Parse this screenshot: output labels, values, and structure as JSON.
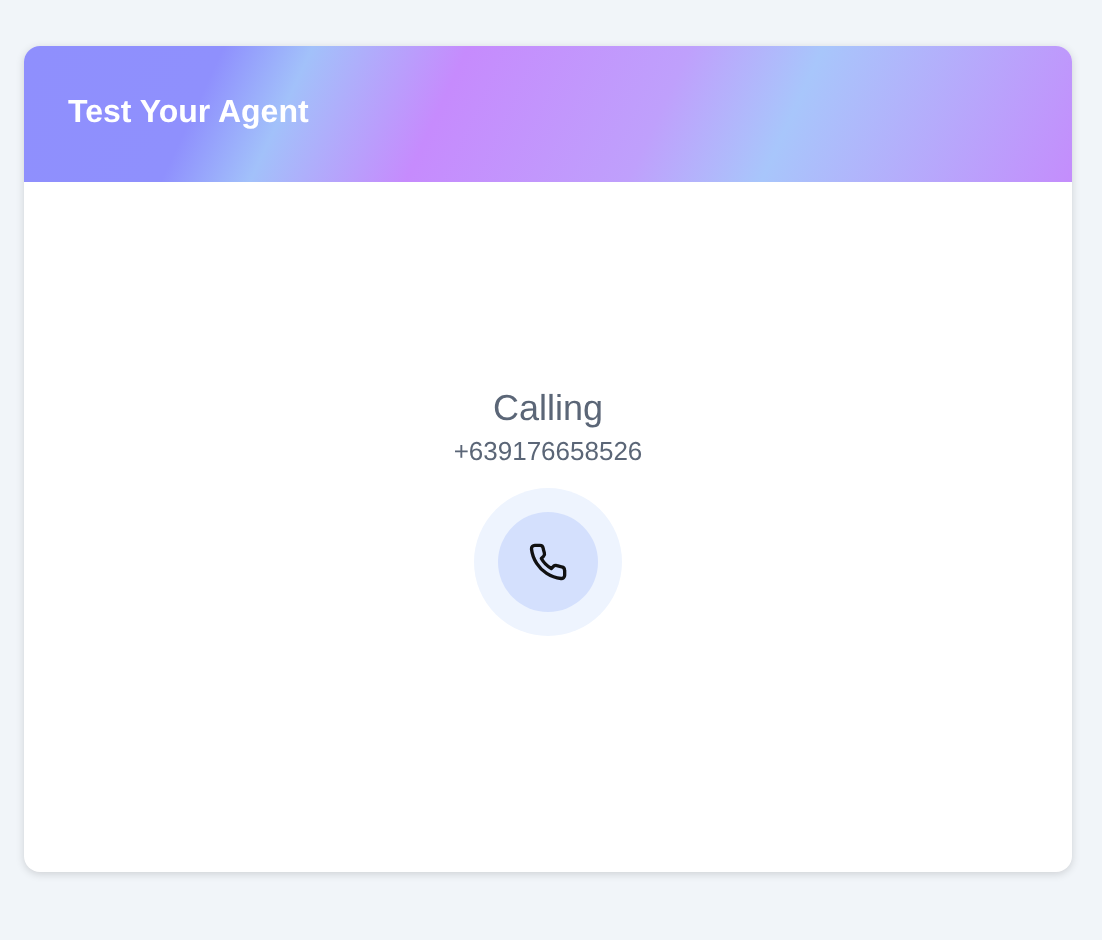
{
  "card": {
    "title": "Test Your Agent"
  },
  "call": {
    "status": "Calling",
    "number": "+639176658526"
  }
}
